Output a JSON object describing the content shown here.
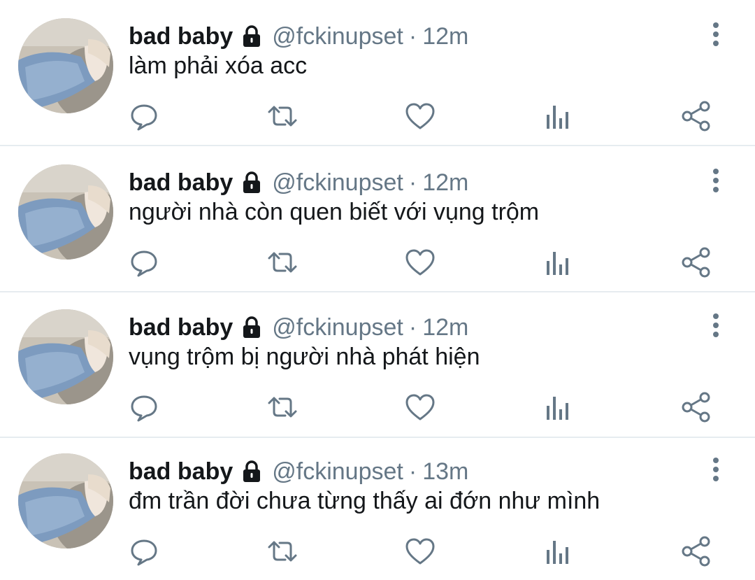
{
  "colors": {
    "icon": "#657786",
    "name": "#14171a",
    "divider": "#e6ecf0"
  },
  "tweets": [
    {
      "name": "bad baby",
      "handle": "@fckinupset",
      "separator": "·",
      "time": "12m",
      "text": "làm phải xóa acc"
    },
    {
      "name": "bad baby",
      "handle": "@fckinupset",
      "separator": "·",
      "time": "12m",
      "text": "người nhà còn quen biết với vụng trộm"
    },
    {
      "name": "bad baby",
      "handle": "@fckinupset",
      "separator": "·",
      "time": "12m",
      "text": "vụng trộm bị người nhà phát hiện"
    },
    {
      "name": "bad baby",
      "handle": "@fckinupset",
      "separator": "·",
      "time": "13m",
      "text": "đm trần đời chưa từng thấy ai đớn như mình"
    }
  ],
  "icons": {
    "avatar": "avatar-photo",
    "lock": "lock-icon",
    "more": "more-vertical-icon",
    "reply": "reply-icon",
    "retweet": "retweet-icon",
    "like": "heart-icon",
    "analytics": "analytics-icon",
    "share": "share-icon"
  }
}
